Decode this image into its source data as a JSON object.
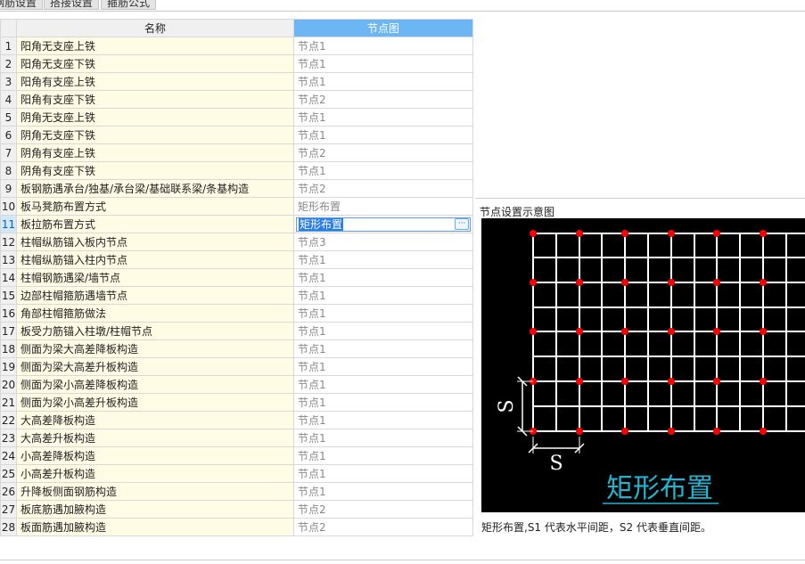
{
  "tabs": [
    "钢筋设置",
    "搭接设置",
    "箍筋公式"
  ],
  "grid": {
    "columns": {
      "name": "名称",
      "node": "节点图"
    },
    "active_row": 11,
    "rows": [
      {
        "num": "1",
        "name": "阳角无支座上铁",
        "value": "节点1"
      },
      {
        "num": "2",
        "name": "阳角无支座下铁",
        "value": "节点1"
      },
      {
        "num": "3",
        "name": "阳角有支座上铁",
        "value": "节点1"
      },
      {
        "num": "4",
        "name": "阳角有支座下铁",
        "value": "节点2"
      },
      {
        "num": "5",
        "name": "阴角无支座上铁",
        "value": "节点1"
      },
      {
        "num": "6",
        "name": "阴角无支座下铁",
        "value": "节点1"
      },
      {
        "num": "7",
        "name": "阴角有支座上铁",
        "value": "节点2"
      },
      {
        "num": "8",
        "name": "阴角有支座下铁",
        "value": "节点1"
      },
      {
        "num": "9",
        "name": "板钢筋遇承台/独基/承台梁/基础联系梁/条基构造",
        "value": "节点2"
      },
      {
        "num": "10",
        "name": "板马凳筋布置方式",
        "value": "矩形布置"
      },
      {
        "num": "11",
        "name": "板拉筋布置方式",
        "value": "矩形布置"
      },
      {
        "num": "12",
        "name": "柱帽纵筋锚入板内节点",
        "value": "节点3"
      },
      {
        "num": "13",
        "name": "柱帽纵筋锚入柱内节点",
        "value": "节点1"
      },
      {
        "num": "14",
        "name": "柱帽钢筋遇梁/墙节点",
        "value": "节点1"
      },
      {
        "num": "15",
        "name": "边部柱帽箍筋遇墙节点",
        "value": "节点1"
      },
      {
        "num": "16",
        "name": "角部柱帽箍筋做法",
        "value": "节点1"
      },
      {
        "num": "17",
        "name": "板受力筋锚入柱墩/柱帽节点",
        "value": "节点1"
      },
      {
        "num": "18",
        "name": "侧面为梁大高差降板构造",
        "value": "节点1"
      },
      {
        "num": "19",
        "name": "侧面为梁大高差升板构造",
        "value": "节点1"
      },
      {
        "num": "20",
        "name": "侧面为梁小高差降板构造",
        "value": "节点1"
      },
      {
        "num": "21",
        "name": "侧面为梁小高差升板构造",
        "value": "节点1"
      },
      {
        "num": "22",
        "name": "大高差降板构造",
        "value": "节点1"
      },
      {
        "num": "23",
        "name": "大高差升板构造",
        "value": "节点1"
      },
      {
        "num": "24",
        "name": "小高差降板构造",
        "value": "节点1"
      },
      {
        "num": "25",
        "name": "小高差升板构造",
        "value": "节点1"
      },
      {
        "num": "26",
        "name": "升降板侧面钢筋构造",
        "value": "节点1"
      },
      {
        "num": "27",
        "name": "板底筋遇加腋构造",
        "value": "节点2"
      },
      {
        "num": "28",
        "name": "板面筋遇加腋构造",
        "value": "节点2"
      }
    ]
  },
  "editor": {
    "ellipsis_icon": "ellipsis-icon"
  },
  "preview": {
    "title": "节点设置示意图",
    "diagram_label": "矩形布置",
    "dim_s": "S",
    "description": "矩形布置,S1 代表水平间距，S2 代表垂直间距。",
    "colors": {
      "background": "#000000",
      "grid": "#ffffff",
      "dots": "#ff0000",
      "label": "#1fb4cf"
    }
  }
}
